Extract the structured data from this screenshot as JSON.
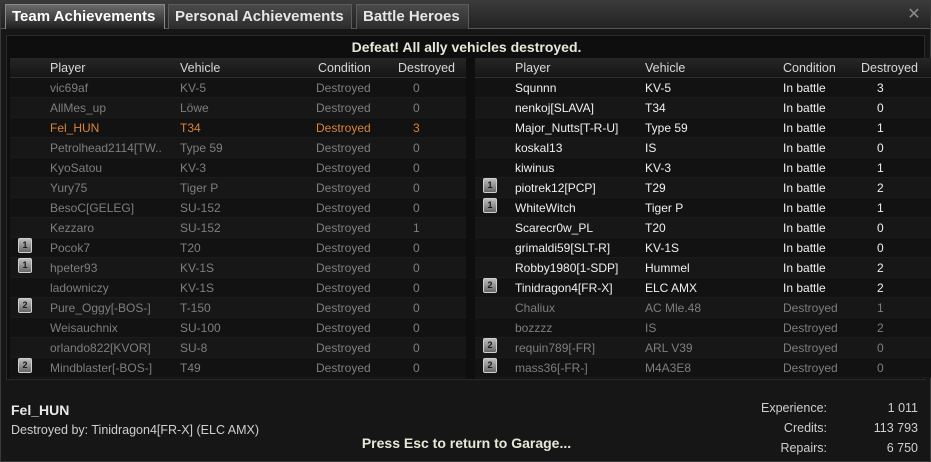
{
  "tabs": [
    "Team Achievements",
    "Personal Achievements",
    "Battle Heroes"
  ],
  "result": "Defeat! All ally vehicles destroyed.",
  "columns": {
    "player": "Player",
    "vehicle": "Vehicle",
    "condition": "Condition",
    "destroyed": "Destroyed"
  },
  "left_team": [
    {
      "player": "vic69af",
      "vehicle": "KV-5",
      "condition": "Destroyed",
      "destroyed": "0",
      "state": "dead",
      "rank": ""
    },
    {
      "player": "AllMes_up",
      "vehicle": "Löwe",
      "condition": "Destroyed",
      "destroyed": "0",
      "state": "dead",
      "rank": ""
    },
    {
      "player": "Fel_HUN",
      "vehicle": "T34",
      "condition": "Destroyed",
      "destroyed": "3",
      "state": "me",
      "rank": ""
    },
    {
      "player": "Petrolhead2114[TW..",
      "vehicle": "Type 59",
      "condition": "Destroyed",
      "destroyed": "0",
      "state": "dead",
      "rank": ""
    },
    {
      "player": "KyoSatou",
      "vehicle": "KV-3",
      "condition": "Destroyed",
      "destroyed": "0",
      "state": "dead",
      "rank": ""
    },
    {
      "player": "Yury75",
      "vehicle": "Tiger P",
      "condition": "Destroyed",
      "destroyed": "0",
      "state": "dead",
      "rank": ""
    },
    {
      "player": "BesoC[GELEG]",
      "vehicle": "SU-152",
      "condition": "Destroyed",
      "destroyed": "0",
      "state": "dead",
      "rank": ""
    },
    {
      "player": "Kezzaro",
      "vehicle": "SU-152",
      "condition": "Destroyed",
      "destroyed": "1",
      "state": "dead",
      "rank": ""
    },
    {
      "player": "Pocok7",
      "vehicle": "T20",
      "condition": "Destroyed",
      "destroyed": "0",
      "state": "dead",
      "rank": "1"
    },
    {
      "player": "hpeter93",
      "vehicle": "KV-1S",
      "condition": "Destroyed",
      "destroyed": "0",
      "state": "dead",
      "rank": "1"
    },
    {
      "player": "ladowniczy",
      "vehicle": "KV-1S",
      "condition": "Destroyed",
      "destroyed": "0",
      "state": "dead",
      "rank": ""
    },
    {
      "player": "Pure_Oggy[-BOS-]",
      "vehicle": "T-150",
      "condition": "Destroyed",
      "destroyed": "0",
      "state": "dead",
      "rank": "2"
    },
    {
      "player": "Weisauchnix",
      "vehicle": "SU-100",
      "condition": "Destroyed",
      "destroyed": "0",
      "state": "dead",
      "rank": ""
    },
    {
      "player": "orlando822[KVOR]",
      "vehicle": "SU-8",
      "condition": "Destroyed",
      "destroyed": "0",
      "state": "dead",
      "rank": ""
    },
    {
      "player": "Mindblaster[-BOS-]",
      "vehicle": "T49",
      "condition": "Destroyed",
      "destroyed": "0",
      "state": "dead",
      "rank": "2"
    }
  ],
  "right_team": [
    {
      "player": "Squnnn",
      "vehicle": "KV-5",
      "condition": "In battle",
      "destroyed": "3",
      "state": "alive",
      "rank": ""
    },
    {
      "player": "nenkoj[SLAVA]",
      "vehicle": "T34",
      "condition": "In battle",
      "destroyed": "0",
      "state": "alive",
      "rank": ""
    },
    {
      "player": "Major_Nutts[T-R-U]",
      "vehicle": "Type 59",
      "condition": "In battle",
      "destroyed": "1",
      "state": "alive",
      "rank": ""
    },
    {
      "player": "koskal13",
      "vehicle": "IS",
      "condition": "In battle",
      "destroyed": "0",
      "state": "alive",
      "rank": ""
    },
    {
      "player": "kiwinus",
      "vehicle": "KV-3",
      "condition": "In battle",
      "destroyed": "1",
      "state": "alive",
      "rank": ""
    },
    {
      "player": "piotrek12[PCP]",
      "vehicle": "T29",
      "condition": "In battle",
      "destroyed": "2",
      "state": "alive",
      "rank": "1"
    },
    {
      "player": "WhiteWitch",
      "vehicle": "Tiger P",
      "condition": "In battle",
      "destroyed": "1",
      "state": "alive",
      "rank": "1"
    },
    {
      "player": "Scarecr0w_PL",
      "vehicle": "T20",
      "condition": "In battle",
      "destroyed": "0",
      "state": "alive",
      "rank": ""
    },
    {
      "player": "grimaldi59[SLT-R]",
      "vehicle": "KV-1S",
      "condition": "In battle",
      "destroyed": "0",
      "state": "alive",
      "rank": ""
    },
    {
      "player": "Robby1980[1-SDP]",
      "vehicle": "Hummel",
      "condition": "In battle",
      "destroyed": "2",
      "state": "alive",
      "rank": ""
    },
    {
      "player": "Tinidragon4[FR-X]",
      "vehicle": "ELC AMX",
      "condition": "In battle",
      "destroyed": "2",
      "state": "alive",
      "rank": "2"
    },
    {
      "player": "Chaliux",
      "vehicle": "AC Mle.48",
      "condition": "Destroyed",
      "destroyed": "1",
      "state": "dead",
      "rank": ""
    },
    {
      "player": "bozzzz",
      "vehicle": "IS",
      "condition": "Destroyed",
      "destroyed": "2",
      "state": "dead",
      "rank": ""
    },
    {
      "player": "requin789[-FR]",
      "vehicle": "ARL V39",
      "condition": "Destroyed",
      "destroyed": "0",
      "state": "dead",
      "rank": "2"
    },
    {
      "player": "mass36[-FR-]",
      "vehicle": "M4A3E8",
      "condition": "Destroyed",
      "destroyed": "0",
      "state": "dead",
      "rank": "2"
    }
  ],
  "footer": {
    "player_name": "Fel_HUN",
    "destroyed_by": "Destroyed by: Tinidragon4[FR-X] (ELC AMX)",
    "esc_hint": "Press Esc to return to Garage...",
    "experience_label": "Experience:",
    "experience": "1 011",
    "credits_label": "Credits:",
    "credits": "113 793",
    "repairs_label": "Repairs:",
    "repairs": "6 750"
  },
  "colors": {
    "self": "#d9843a",
    "alive": "#f0f0f0",
    "dead": "#7e7e7e"
  }
}
